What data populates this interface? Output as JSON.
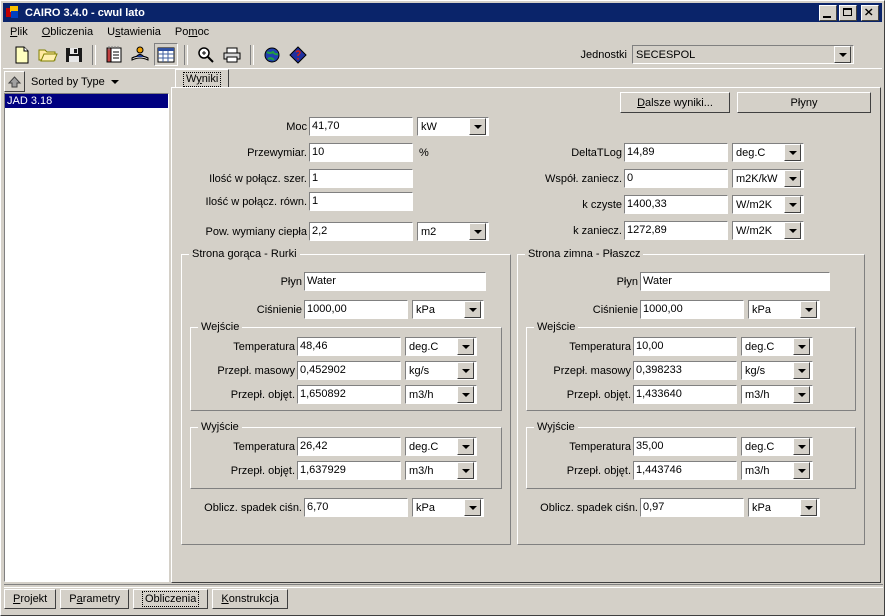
{
  "window": {
    "title": "CAIRO 3.4.0 - cwuI lato",
    "icon": "app-icon",
    "buttons": {
      "minimize": "_",
      "maximize": "□",
      "close": "×"
    }
  },
  "menu": [
    {
      "label": "Plik",
      "accel": "P"
    },
    {
      "label": "Obliczenia",
      "accel": "O"
    },
    {
      "label": "Ustawienia",
      "accel": "s"
    },
    {
      "label": "Pomoc",
      "accel": "m"
    }
  ],
  "toolbar": {
    "icons": [
      "new-document-icon",
      "open-folder-icon",
      "save-disk-icon",
      "notebook-icon",
      "user-manual-icon",
      "table-grid-icon",
      "zoom-icon",
      "print-icon",
      "globe-icon",
      "help-diamond-icon"
    ],
    "units_label": "Jednostki",
    "units_value": "SECESPOL"
  },
  "sidebar": {
    "up_button": "up-arrow-icon",
    "sort_label": "Sorted by Type",
    "items": [
      {
        "label": "JAD 3.18",
        "selected": true
      }
    ]
  },
  "tabs": {
    "results": "Wyniki"
  },
  "actions": {
    "more_results": "Dalsze wyniki...",
    "more_results_accel": "D",
    "fluids": "Płyny"
  },
  "summary_left": [
    {
      "label": "Moc",
      "value": "41,70",
      "unit": "kW"
    },
    {
      "label": "Przewymiar.",
      "value": "10",
      "unit": "%",
      "unit_plain": true
    },
    {
      "label": "Ilość w połącz. szer.",
      "value": "1",
      "unit": ""
    },
    {
      "label": "Ilość w połącz. równ.",
      "value": "1",
      "unit": ""
    },
    {
      "label": "Pow. wymiany ciepła",
      "value": "2,2",
      "unit": "m2"
    }
  ],
  "summary_right": [
    {
      "label": "DeltaTLog",
      "value": "14,89",
      "unit": "deg.C"
    },
    {
      "label": "Współ. zaniecz.",
      "value": "0",
      "unit": "m2K/kW"
    },
    {
      "label": "k czyste",
      "value": "1400,33",
      "unit": "W/m2K"
    },
    {
      "label": "k zaniecz.",
      "value": "1272,89",
      "unit": "W/m2K"
    }
  ],
  "hot_side": {
    "legend": "Strona gorąca - Rurki",
    "fluid_label": "Płyn",
    "fluid_value": "Water",
    "pressure_label": "Ciśnienie",
    "pressure_value": "1000,00",
    "pressure_unit": "kPa",
    "inlet": {
      "legend": "Wejście",
      "rows": [
        {
          "label": "Temperatura",
          "value": "48,46",
          "unit": "deg.C"
        },
        {
          "label": "Przepł. masowy",
          "value": "0,452902",
          "unit": "kg/s"
        },
        {
          "label": "Przepł. objęt.",
          "value": "1,650892",
          "unit": "m3/h"
        }
      ]
    },
    "outlet": {
      "legend": "Wyjście",
      "rows": [
        {
          "label": "Temperatura",
          "value": "26,42",
          "unit": "deg.C"
        },
        {
          "label": "Przepł. objęt.",
          "value": "1,637929",
          "unit": "m3/h"
        }
      ]
    },
    "pressure_drop": {
      "label": "Oblicz. spadek ciśn.",
      "value": "6,70",
      "unit": "kPa"
    }
  },
  "cold_side": {
    "legend": "Strona zimna - Płaszcz",
    "fluid_label": "Płyn",
    "fluid_value": "Water",
    "pressure_label": "Ciśnienie",
    "pressure_value": "1000,00",
    "pressure_unit": "kPa",
    "inlet": {
      "legend": "Wejście",
      "rows": [
        {
          "label": "Temperatura",
          "value": "10,00",
          "unit": "deg.C"
        },
        {
          "label": "Przepł. masowy",
          "value": "0,398233",
          "unit": "kg/s"
        },
        {
          "label": "Przepł. objęt.",
          "value": "1,433640",
          "unit": "m3/h"
        }
      ]
    },
    "outlet": {
      "legend": "Wyjście",
      "rows": [
        {
          "label": "Temperatura",
          "value": "35,00",
          "unit": "deg.C"
        },
        {
          "label": "Przepł. objęt.",
          "value": "1,443746",
          "unit": "m3/h"
        }
      ]
    },
    "pressure_drop": {
      "label": "Oblicz. spadek ciśn.",
      "value": "0,97",
      "unit": "kPa"
    }
  },
  "bottom_tabs": [
    {
      "label": "Projekt",
      "accel": "P",
      "active": false
    },
    {
      "label": "Parametry",
      "accel": "a",
      "active": false
    },
    {
      "label": "Obliczenia",
      "accel": "",
      "active": true
    },
    {
      "label": "Konstrukcja",
      "accel": "K",
      "active": false
    }
  ],
  "colors": {
    "face": "#d4d0c8",
    "title_bar": "#0a246a",
    "selection": "#000080",
    "field_bg": "#ffffff"
  }
}
